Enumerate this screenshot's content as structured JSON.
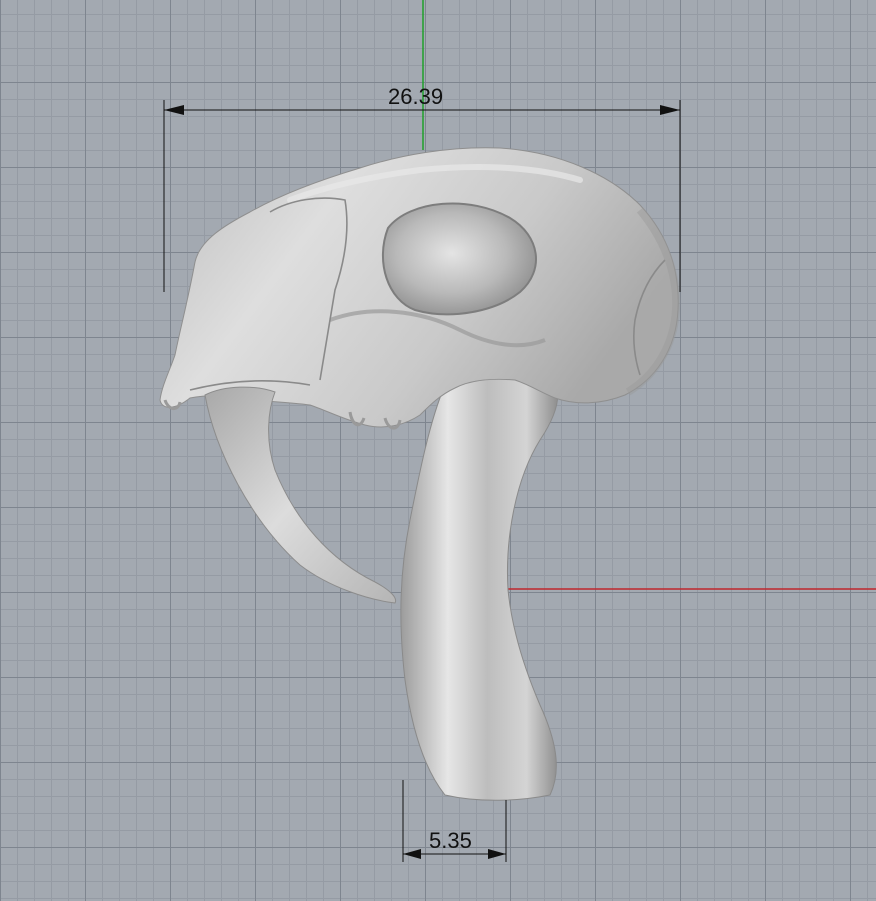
{
  "viewport": {
    "title": "",
    "colors": {
      "background": "#a3a9b1",
      "grid_major": "#7e858f",
      "grid_minor": "#959ba4",
      "y_axis": "#1fa02a",
      "x_axis": "#c0272d",
      "model": "#c4c4c4",
      "dimension_line": "#111111"
    }
  },
  "model": {
    "icon": "saber-tooth-skull-pendant-model"
  },
  "dimensions": {
    "top": {
      "value": "26.39"
    },
    "bottom": {
      "value": "5.35"
    }
  }
}
